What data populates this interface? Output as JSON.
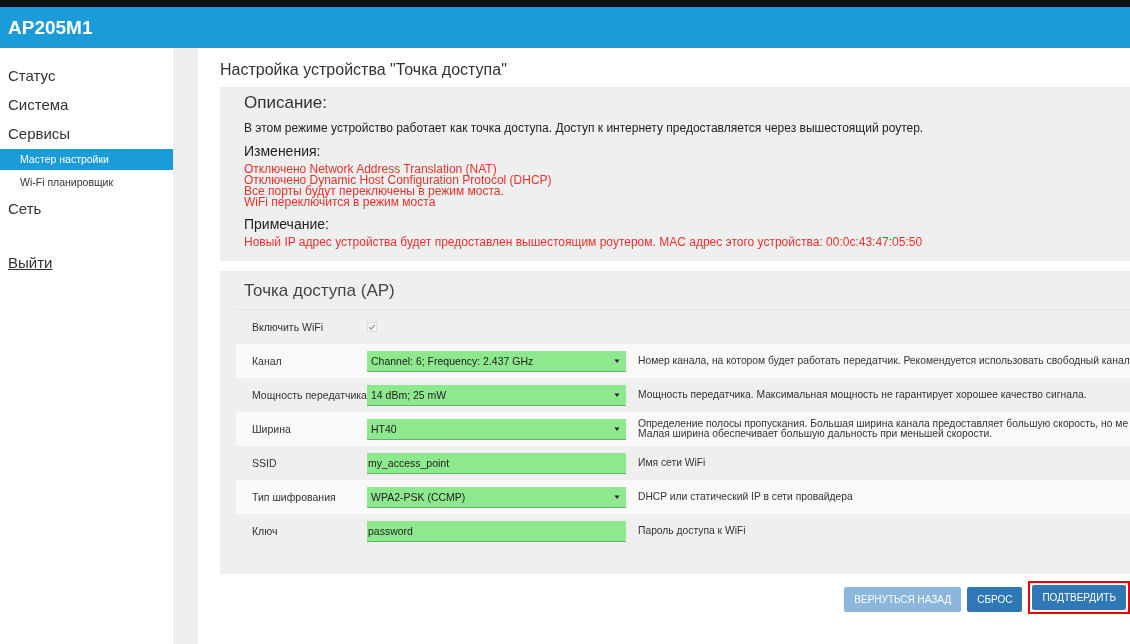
{
  "header": {
    "title": "AP205M1"
  },
  "sidebar": {
    "items": [
      {
        "label": "Статус",
        "selected": false
      },
      {
        "label": "Система",
        "selected": false
      },
      {
        "label": "Сервисы",
        "selected": false,
        "children": [
          {
            "label": "Мастер настройки",
            "selected": true
          },
          {
            "label": "Wi-Fi планировщик",
            "selected": false
          }
        ]
      },
      {
        "label": "Сеть",
        "selected": false
      }
    ],
    "logout": "Выйти"
  },
  "page_title": "Настройка устройства \"Точка доступа\"",
  "info_panel": {
    "sections": [
      {
        "heading": "Описание:",
        "kind": "normal",
        "lines": [
          "В этом режиме устройство работает как точка доступа. Доступ к интернету предоставляется через вышестоящий роутер."
        ]
      },
      {
        "heading": "Изменения:",
        "kind": "warning",
        "lines": [
          "Отключено Network Address Translation (NAT)",
          "Отключено Dynamic Host Configuration Protocol (DHCP)",
          "Все порты будут переключены в режим моста.",
          "WiFi переключится в режим моста"
        ]
      },
      {
        "heading": "Примечание:",
        "kind": "warning",
        "lines": [
          "Новый IP адрес устройства будет предоставлен вышестоящим роутером. MAC адрес этого устройства: 00:0c:43:47:05:50"
        ]
      }
    ]
  },
  "ap_panel": {
    "title": "Точка доступа (AP)",
    "rows": [
      {
        "kind": "checkbox",
        "label": "Включить WiFi",
        "checked": true
      },
      {
        "kind": "select",
        "label": "Канал",
        "value": "Channel: 6; Frequency: 2.437 GHz",
        "hint": [
          "Номер канала, на котором будет работать передатчик. Рекомендуется использовать свободный канал"
        ]
      },
      {
        "kind": "select",
        "label": "Мощность передатчика",
        "value": "14 dBm; 25 mW",
        "hint": [
          "Мощность передатчика. Максимальная мощность не гарантирует хорошее качество сигнала."
        ]
      },
      {
        "kind": "select",
        "label": "Ширина",
        "value": "HT40",
        "hint": [
          "Определение полосы пропускания. Большая ширина канала предоставляет большую скорость, но ме",
          "Малая ширина обеспечивает большую дальность при меньшей скорости."
        ]
      },
      {
        "kind": "text",
        "label": "SSID",
        "value": "my_access_point",
        "hint": [
          "Имя сети WiFi"
        ]
      },
      {
        "kind": "select",
        "label": "Тип шифрования",
        "value": "WPA2-PSK (CCMP)",
        "hint": [
          "DHCP или статический IP в сети провайдера"
        ]
      },
      {
        "kind": "text",
        "label": "Ключ",
        "value": "password",
        "hint": [
          "Пароль доступа к WiFi"
        ]
      }
    ]
  },
  "buttons": [
    {
      "label": "ВЕРНУТЬСЯ НАЗАД",
      "disabled": true,
      "highlighted": false
    },
    {
      "label": "СБРОС",
      "disabled": false,
      "highlighted": false
    },
    {
      "label": "ПОДТВЕРДИТЬ",
      "disabled": false,
      "highlighted": true
    }
  ]
}
